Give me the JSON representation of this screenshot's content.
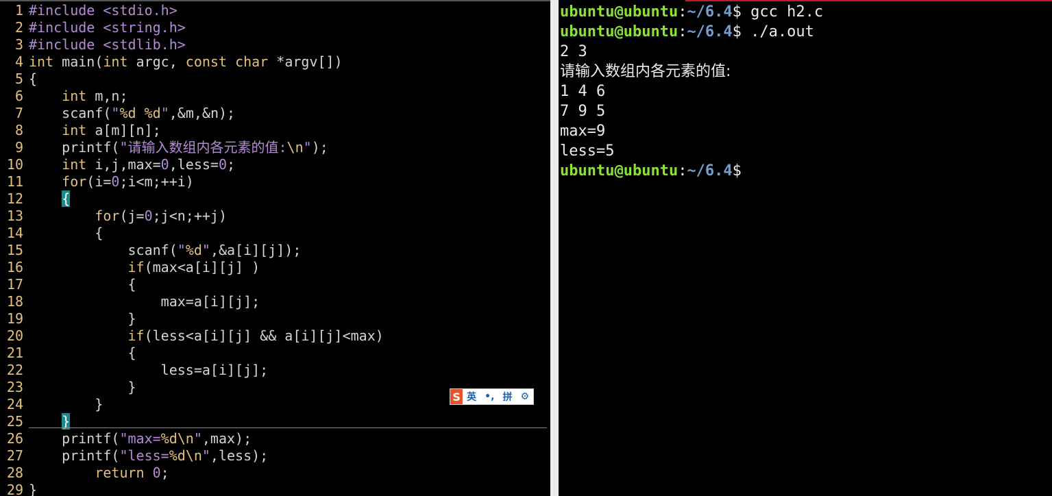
{
  "editor": {
    "lines": [
      {
        "n": "1",
        "html": "<span class='pp'>#include</span> <span class='inc'>&lt;stdio.h&gt;</span>"
      },
      {
        "n": "2",
        "html": "<span class='pp'>#include</span> <span class='inc'>&lt;string.h&gt;</span>"
      },
      {
        "n": "3",
        "html": "<span class='pp'>#include</span> <span class='inc'>&lt;stdlib.h&gt;</span>"
      },
      {
        "n": "4",
        "html": "<span class='kw'>int</span> main(<span class='kw'>int</span> argc, <span class='kw'>const</span> <span class='kw'>char</span> *argv[])"
      },
      {
        "n": "5",
        "html": "{"
      },
      {
        "n": "6",
        "html": "    <span class='kw'>int</span> m,n;"
      },
      {
        "n": "7",
        "html": "    scanf(<span class='str'>\"</span><span class='esc'>%d</span><span class='str'> </span><span class='esc'>%d</span><span class='str'>\"</span>,&amp;m,&amp;n);"
      },
      {
        "n": "8",
        "html": "    <span class='kw'>int</span> a[m][n];"
      },
      {
        "n": "9",
        "html": "    printf(<span class='str'>\"请输入数组内各元素的值:</span><span class='esc'>\\n</span><span class='str'>\"</span>);"
      },
      {
        "n": "10",
        "html": "    <span class='kw'>int</span> i,j,max=<span class='num'>0</span>,less=<span class='num'>0</span>;"
      },
      {
        "n": "11",
        "html": "    <span class='kw'>for</span>(i=<span class='num'>0</span>;i&lt;m;++i)"
      },
      {
        "n": "12",
        "html": "    <span class='match'>{</span>"
      },
      {
        "n": "13",
        "html": "        <span class='kw'>for</span>(j=<span class='num'>0</span>;j&lt;n;++j)"
      },
      {
        "n": "14",
        "html": "        {"
      },
      {
        "n": "15",
        "html": "            scanf(<span class='str'>\"</span><span class='esc'>%d</span><span class='str'>\"</span>,&amp;a[i][j]);"
      },
      {
        "n": "16",
        "html": "            <span class='kw'>if</span>(max&lt;a[i][j] )"
      },
      {
        "n": "17",
        "html": "            {"
      },
      {
        "n": "18",
        "html": "                max=a[i][j];"
      },
      {
        "n": "19",
        "html": "            }"
      },
      {
        "n": "20",
        "html": "            <span class='kw'>if</span>(less&lt;a[i][j] &amp;&amp; a[i][j]&lt;max)"
      },
      {
        "n": "21",
        "html": "            {"
      },
      {
        "n": "22",
        "html": "                less=a[i][j];"
      },
      {
        "n": "23",
        "html": "            }"
      },
      {
        "n": "24",
        "html": "        }"
      },
      {
        "n": "25",
        "html": "    <span class='match'>}</span>"
      },
      {
        "n": "26",
        "html": "    printf(<span class='str'>\"max=</span><span class='esc'>%d\\n</span><span class='str'>\"</span>,max);"
      },
      {
        "n": "27",
        "html": "    printf(<span class='str'>\"less=</span><span class='esc'>%d\\n</span><span class='str'>\"</span>,less);"
      },
      {
        "n": "28",
        "html": "        <span class='kw'>return</span> <span class='num'>0</span>;"
      },
      {
        "n": "29",
        "html": "}"
      }
    ]
  },
  "ime": {
    "logo": "S",
    "lang": "英",
    "punct": "•,",
    "mode": "拼",
    "settings": "⚙"
  },
  "terminal": {
    "lines": [
      {
        "user": "ubuntu@ubuntu",
        "sep": ":",
        "path": "~/6.4",
        "prompt": "$ ",
        "cmd": "gcc h2.c"
      },
      {
        "user": "ubuntu@ubuntu",
        "sep": ":",
        "path": "~/6.4",
        "prompt": "$ ",
        "cmd": "./a.out"
      },
      {
        "out": "2 3"
      },
      {
        "out": "请输入数组内各元素的值:"
      },
      {
        "out": "1 4 6"
      },
      {
        "out": "7 9 5"
      },
      {
        "out": "max=9"
      },
      {
        "out": "less=5"
      },
      {
        "user": "ubuntu@ubuntu",
        "sep": ":",
        "path": "~/6.4",
        "prompt": "$",
        "cmd": ""
      }
    ]
  }
}
